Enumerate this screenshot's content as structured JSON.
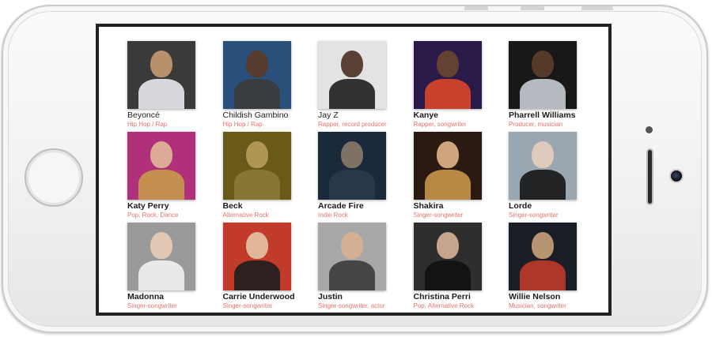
{
  "colors": {
    "genre_text": "#e8736b",
    "name_text": "#1b1b1b",
    "screen_border": "#222222"
  },
  "artists": [
    {
      "name": "Beyoncé",
      "genre": "Hip Hop / Rap",
      "bold": false,
      "bg": "#3a3a3a",
      "skin": "#c89a72",
      "cloth": "#e9e9ef"
    },
    {
      "name": "Childish Gambino",
      "genre": "Hip Hop / Rap",
      "bold": false,
      "bg": "#2a4f7a",
      "skin": "#5a3a26",
      "cloth": "#3b3b3b"
    },
    {
      "name": "Jay Z",
      "genre": "Rapper, record producer",
      "bold": false,
      "bg": "#e3e3e3",
      "skin": "#4a2f22",
      "cloth": "#1e1e1e"
    },
    {
      "name": "Kanye",
      "genre": "Rapper, songwriter",
      "bold": true,
      "bg": "#2a1a4a",
      "skin": "#6b4630",
      "cloth": "#d9462a"
    },
    {
      "name": "Pharrell Williams",
      "genre": "Producer, musician",
      "bold": true,
      "bg": "#181818",
      "skin": "#5c3d2b",
      "cloth": "#c6cbd3"
    },
    {
      "name": "Katy Perry",
      "genre": "Pop, Rock, Dance",
      "bold": true,
      "bg": "#b0307a",
      "skin": "#e1b89a",
      "cloth": "#c79a4a"
    },
    {
      "name": "Beck",
      "genre": "Alternative Rock",
      "bold": true,
      "bg": "#6a5a1a",
      "skin": "#b89c5a",
      "cloth": "#8a7a3a"
    },
    {
      "name": "Arcade Fire",
      "genre": "Indie Rock",
      "bold": true,
      "bg": "#1a2a3a",
      "skin": "#8a7a6a",
      "cloth": "#2a3a4a"
    },
    {
      "name": "Shakira",
      "genre": "Singer-songwriter",
      "bold": true,
      "bg": "#2a1a12",
      "skin": "#e0b58a",
      "cloth": "#c9954a"
    },
    {
      "name": "Lorde",
      "genre": "Singer-songwriter",
      "bold": true,
      "bg": "#9aa6b0",
      "skin": "#e6cfc0",
      "cloth": "#151515"
    },
    {
      "name": "Madonna",
      "genre": "Singer-songwriter",
      "bold": true,
      "bg": "#9a9a9a",
      "skin": "#e8cdb8",
      "cloth": "#f2f2f2"
    },
    {
      "name": "Carrie Underwood",
      "genre": "Singer-songwriter",
      "bold": true,
      "bg": "#c23a2a",
      "skin": "#e6c4a4",
      "cloth": "#1e1e1e"
    },
    {
      "name": "Justin",
      "genre": "Singer-songwriter, actor",
      "bold": true,
      "bg": "#a8a8a8",
      "skin": "#d9b090",
      "cloth": "#3a3a3a"
    },
    {
      "name": "Christina Perri",
      "genre": "Pop, Alternative Rock",
      "bold": true,
      "bg": "#2e2e2e",
      "skin": "#d8b398",
      "cloth": "#111111"
    },
    {
      "name": "Willie Nelson",
      "genre": "Musician, songwriter",
      "bold": true,
      "bg": "#1a1e26",
      "skin": "#c8a07a",
      "cloth": "#c0392b"
    }
  ]
}
